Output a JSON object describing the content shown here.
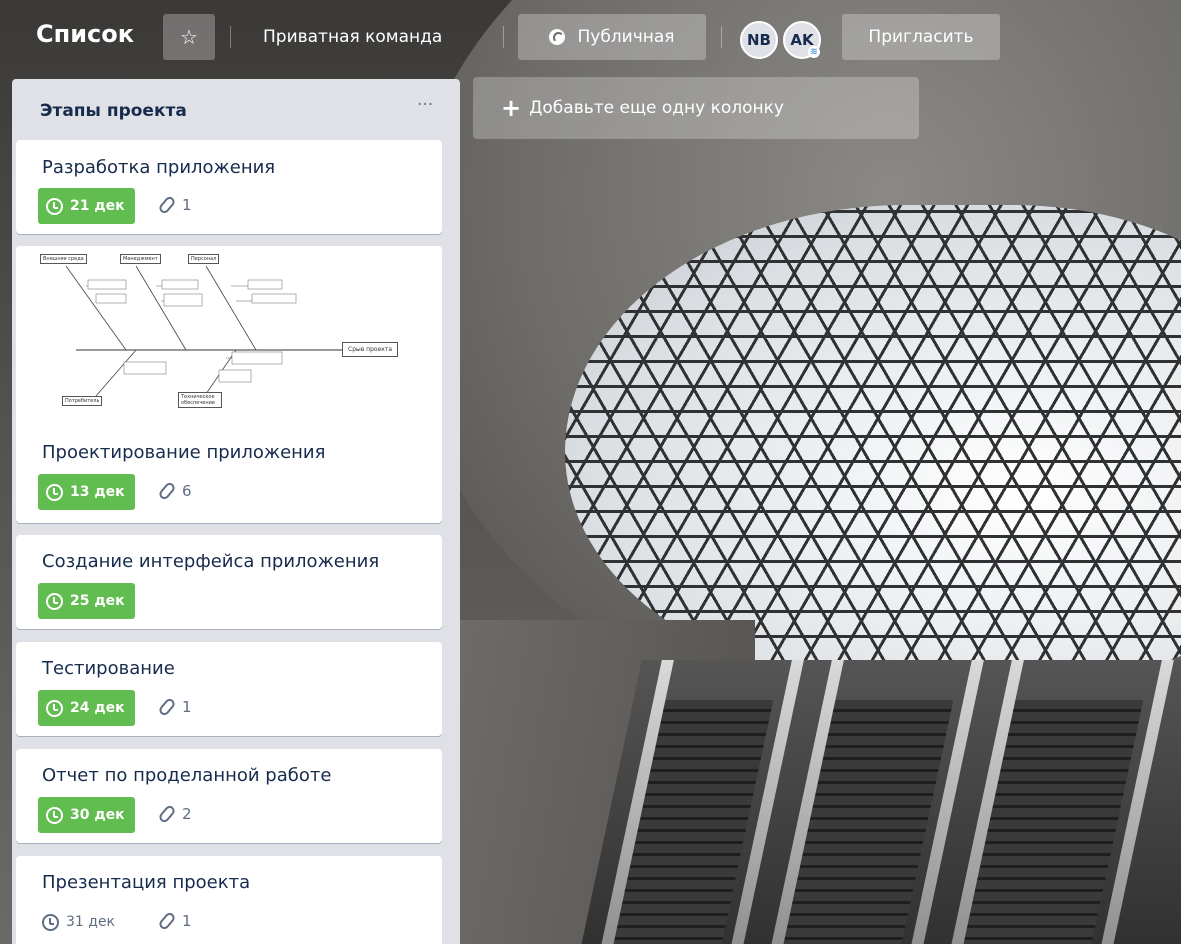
{
  "header": {
    "board_title": "Список",
    "team": "Приватная команда",
    "visibility": "Публичная",
    "invite": "Пригласить",
    "avatars": [
      "NB",
      "AK"
    ]
  },
  "add_column": {
    "label": "Добавьте еще одну колонку"
  },
  "list": {
    "title": "Этапы проекта",
    "menu_glyph": "···",
    "cards": [
      {
        "title": "Разработка приложения",
        "due": "21 дек",
        "attachments": "1",
        "due_style": "complete"
      },
      {
        "title": "Проектирование приложения",
        "due": "13 дек",
        "attachments": "6",
        "due_style": "complete"
      },
      {
        "title": "Создание интерфейса приложения",
        "due": "25 дек",
        "attachments": null,
        "due_style": "complete"
      },
      {
        "title": "Тестирование",
        "due": "24 дек",
        "attachments": "1",
        "due_style": "complete"
      },
      {
        "title": "Отчет по проделанной работе",
        "due": "30 дек",
        "attachments": "2",
        "due_style": "complete"
      },
      {
        "title": "Презентация проекта",
        "due": "31 дек",
        "attachments": "1",
        "due_style": "plain"
      }
    ]
  },
  "fishbone": {
    "top": [
      "Внешняя среда",
      "Менеджмент",
      "Персонал"
    ],
    "bottom": [
      "Потребитель",
      "Техническое обеспечение"
    ],
    "head": "Срыв проекта"
  },
  "colors": {
    "due_complete": "#61bd4f",
    "list_bg": "#dfe1e6",
    "card_text": "#172b4d"
  }
}
